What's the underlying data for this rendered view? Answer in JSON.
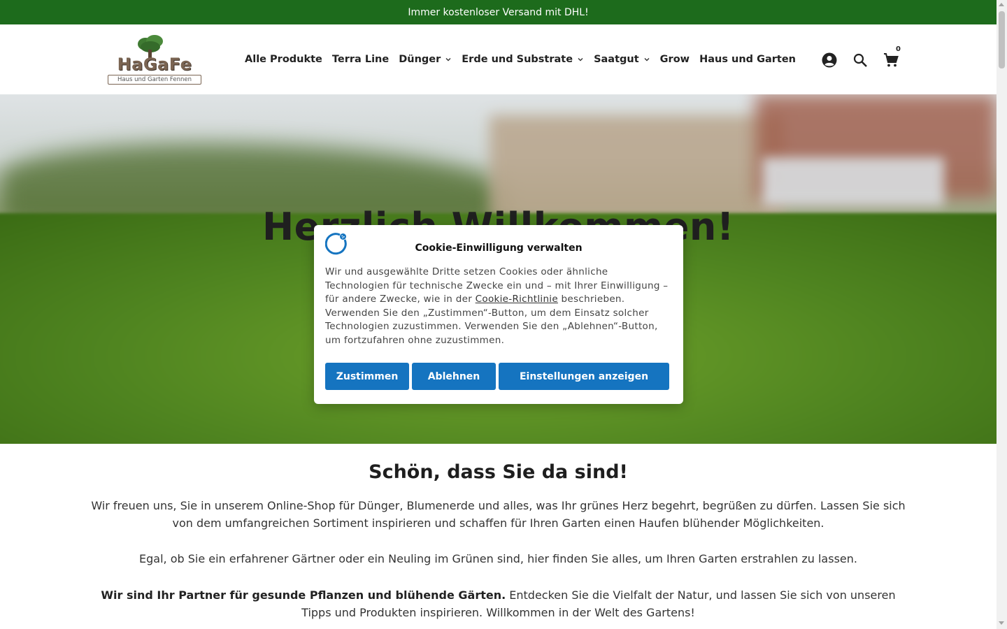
{
  "announcement": {
    "text": "Immer kostenloser Versand mit DHL!"
  },
  "logo": {
    "word": "HaGaFe",
    "subtitle": "Haus und Garten Fennen"
  },
  "nav": {
    "items": [
      {
        "label": "Alle Produkte",
        "has_dropdown": false
      },
      {
        "label": "Terra Line",
        "has_dropdown": false
      },
      {
        "label": "Dünger",
        "has_dropdown": true
      },
      {
        "label": "Erde und Substrate",
        "has_dropdown": true
      },
      {
        "label": "Saatgut",
        "has_dropdown": true
      },
      {
        "label": "Grow",
        "has_dropdown": false
      },
      {
        "label": "Haus und Garten",
        "has_dropdown": false
      }
    ]
  },
  "header_icons": {
    "account": "account-circle-icon",
    "search": "search-icon",
    "cart": "cart-icon",
    "cart_count": "0"
  },
  "hero": {
    "title": "Herzlich Willkommen!"
  },
  "cookie_dialog": {
    "title": "Cookie-Einwilligung verwalten",
    "text_before_link": "Wir und ausgewählte Dritte setzen Cookies oder ähnliche Technologien für technische Zwecke ein und – mit Ihrer Einwilligung – für andere Zwecke, wie in der ",
    "link": "Cookie-Richtlinie",
    "text_after_link": " beschrieben. Verwenden Sie den „Zustimmen“-Button, um dem Einsatz solcher Technologien zuzustimmen. Verwenden Sie den „Ablehnen“-Button, um fortzufahren ohne zuzustimmen.",
    "buttons": {
      "accept": "Zustimmen",
      "reject": "Ablehnen",
      "settings": "Einstellungen anzeigen"
    },
    "button_color": "#1574c0"
  },
  "content": {
    "title": "Schön, dass Sie da sind!",
    "p1": "Wir freuen uns, Sie in unserem Online-Shop für Dünger, Blumenerde und alles, was Ihr grünes Herz begehrt, begrüßen zu dürfen. Lassen Sie sich von dem umfangreichen Sortiment inspirieren und schaffen für Ihren Garten einen Haufen blühender Möglichkeiten.",
    "p2": "Egal, ob Sie ein erfahrener Gärtner oder ein Neuling im Grünen sind, hier finden Sie alles, um Ihren Garten erstrahlen zu lassen.",
    "p3_bold": "Wir sind Ihr Partner für gesunde Pflanzen und blühende Gärten.",
    "p3_rest": " Entdecken Sie die Vielfalt der Natur, und lassen Sie sich von unseren Tipps und Produkten inspirieren. Willkommen in der Welt des Gartens!"
  },
  "colors": {
    "announcement_bg": "#1d6b1c",
    "text": "#222222"
  }
}
